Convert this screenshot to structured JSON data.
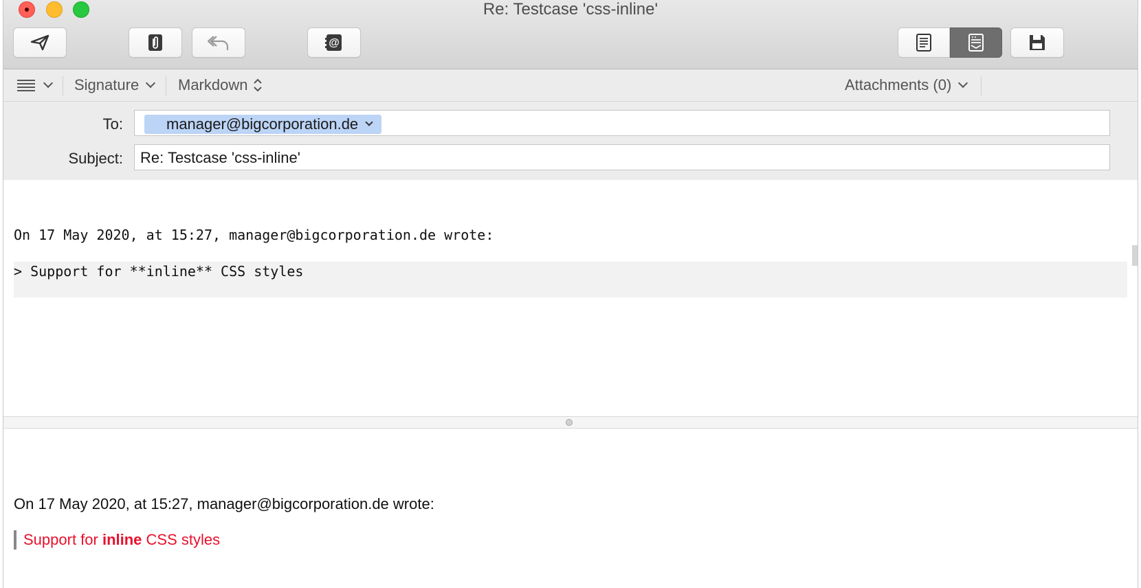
{
  "window": {
    "title": "Re: Testcase 'css-inline'"
  },
  "toolbar": {
    "send_icon": "paper-plane-icon",
    "attach_icon": "paperclip-icon",
    "reply_icon": "reply-arrow-icon",
    "address_icon": "address-book-at-icon",
    "view_plain_icon": "document-lines-icon",
    "view_preview_icon": "split-preview-icon",
    "save_icon": "floppy-disk-icon"
  },
  "formatbar": {
    "signature_label": "Signature",
    "format_label": "Markdown",
    "attachments_label": "Attachments (0)"
  },
  "headers": {
    "to_label": "To:",
    "to_recipient": "manager@bigcorporation.de",
    "subject_label": "Subject:",
    "subject_value": "Re: Testcase 'css-inline'"
  },
  "editor": {
    "wrote_line": "On 17 May 2020, at 15:27, manager@bigcorporation.de wrote:",
    "quote_line": "> Support for **inline** CSS styles"
  },
  "preview": {
    "wrote_line": "On 17 May 2020, at 15:27, manager@bigcorporation.de wrote:",
    "quote_prefix": "Support for ",
    "quote_bold": "inline",
    "quote_suffix": " CSS styles",
    "quote_color": "#e8112d"
  }
}
